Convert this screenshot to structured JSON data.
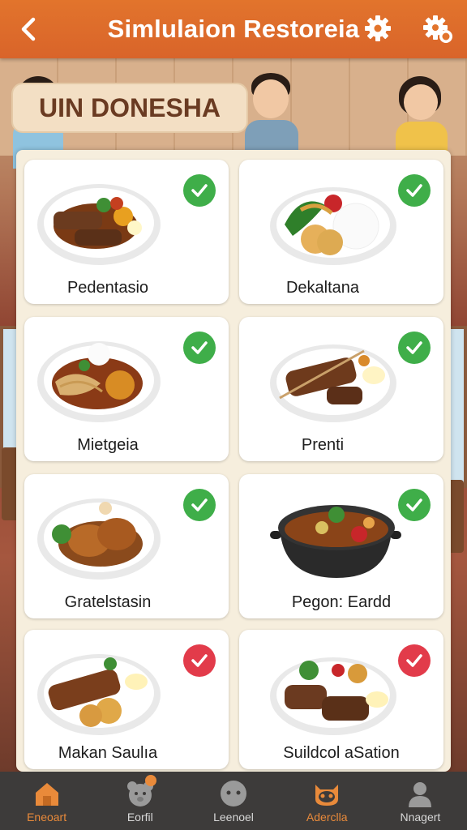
{
  "header": {
    "title": "Simlulaion Restoreia"
  },
  "banner": {
    "text": "UIN DONESHA"
  },
  "menu": {
    "items": [
      {
        "name": "Pedentasio",
        "status": "checked",
        "accent": "#3fae49"
      },
      {
        "name": "Dekaltana",
        "status": "checked",
        "accent": "#3fae49"
      },
      {
        "name": "Mietgeia",
        "status": "checked",
        "accent": "#3fae49"
      },
      {
        "name": "Prenti",
        "status": "checked",
        "accent": "#3fae49"
      },
      {
        "name": "Gratelstasin",
        "status": "checked",
        "accent": "#3fae49"
      },
      {
        "name": "Pegon: Eardd",
        "status": "checked",
        "accent": "#3fae49"
      },
      {
        "name": "Makan Saulıa",
        "status": "selected",
        "accent": "#e23b4a"
      },
      {
        "name": "Suildcol aSation",
        "status": "selected",
        "accent": "#e23b4a"
      }
    ]
  },
  "nav": {
    "items": [
      {
        "label": "Eneoart",
        "icon": "home-icon",
        "active": true
      },
      {
        "label": "Eorfil",
        "icon": "bear-icon",
        "active": false
      },
      {
        "label": "Leenoel",
        "icon": "face-icon",
        "active": false
      },
      {
        "label": "Aderclla",
        "icon": "mascot-icon",
        "active": true
      },
      {
        "label": "Nnagert",
        "icon": "person-icon",
        "active": false
      }
    ]
  },
  "colors": {
    "header": "#e2742c",
    "check_green": "#3fae49",
    "check_red": "#e23b4a",
    "nav_bg": "#3d3b3a",
    "nav_active": "#e98a3a"
  }
}
